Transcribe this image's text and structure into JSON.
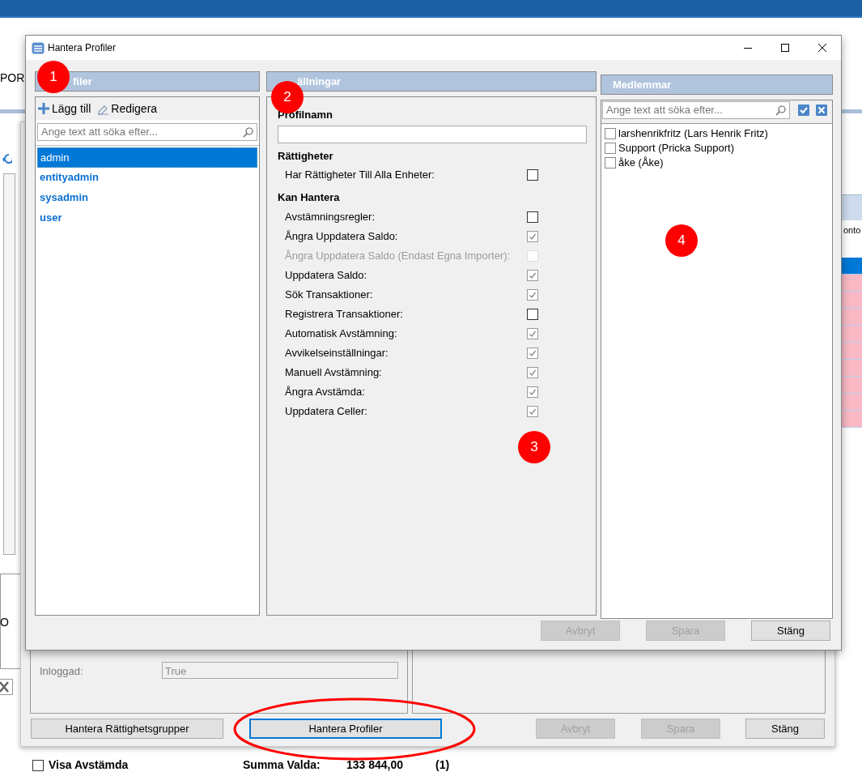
{
  "app": {
    "menu_text": "POR",
    "side_text": "O",
    "column_header": "onto",
    "grid_rows": [
      {
        "selected": true
      },
      {
        "selected": false
      },
      {
        "selected": false
      },
      {
        "selected": false
      },
      {
        "selected": false
      },
      {
        "selected": false
      },
      {
        "selected": false
      },
      {
        "selected": false
      },
      {
        "selected": false
      },
      {
        "selected": false
      }
    ],
    "status_bar": {
      "checkbox": {
        "label": "Visa Avstämda",
        "checked": false
      },
      "sum_label": "Summa Valda:",
      "sum_value": "133 844,00",
      "count": "(1)"
    }
  },
  "user_form": {
    "fields": [
      {
        "label": "Inloggad:",
        "value": "True"
      }
    ],
    "buttons": [
      {
        "label": "Hantera Rättighetsgrupper",
        "disabled": false,
        "focused": false
      },
      {
        "label": "Hantera Profiler",
        "disabled": false,
        "focused": true
      },
      {
        "label": "Avbryt",
        "disabled": true,
        "focused": false
      },
      {
        "label": "Spara",
        "disabled": true,
        "focused": false
      },
      {
        "label": "Stäng",
        "disabled": false,
        "focused": false
      }
    ]
  },
  "dialog": {
    "title": "Hantera Profiler",
    "profiles": {
      "header": "filer",
      "toolbar": [
        {
          "kind": "add",
          "label": "Lägg till"
        },
        {
          "kind": "edit",
          "label": "Redigera"
        }
      ],
      "search": {
        "placeholder": "Ange text att söka efter..."
      },
      "items": [
        {
          "label": "admin",
          "selected": true
        },
        {
          "label": "entityadmin",
          "selected": false
        },
        {
          "label": "sysadmin",
          "selected": false
        },
        {
          "label": "user",
          "selected": false
        }
      ]
    },
    "settings": {
      "header": "ällningar",
      "profile_name_label": "Profilnamn",
      "sections": [
        {
          "title": "Rättigheter",
          "items": [
            {
              "label": "Har Rättigheter Till Alla Enheter:",
              "checked": false,
              "disabled": false
            }
          ]
        },
        {
          "title": "Kan Hantera",
          "items": [
            {
              "label": "Avstämningsregler:",
              "checked": false,
              "disabled": false
            },
            {
              "label": "Ångra Uppdatera Saldo:",
              "checked": true,
              "disabled": false
            },
            {
              "label": "Ångra Uppdatera Saldo (Endast Egna Importer):",
              "checked": false,
              "disabled": true
            },
            {
              "label": "Uppdatera Saldo:",
              "checked": true,
              "disabled": false
            },
            {
              "label": "Sök Transaktioner:",
              "checked": true,
              "disabled": false
            },
            {
              "label": "Registrera Transaktioner:",
              "checked": false,
              "disabled": false
            },
            {
              "label": "Automatisk Avstämning:",
              "checked": true,
              "disabled": false
            },
            {
              "label": "Avvikelseinställningar:",
              "checked": true,
              "disabled": false
            },
            {
              "label": "Manuell Avstämning:",
              "checked": true,
              "disabled": false
            },
            {
              "label": "Ångra Avstämda:",
              "checked": true,
              "disabled": false
            },
            {
              "label": "Uppdatera Celler:",
              "checked": true,
              "disabled": false
            }
          ]
        }
      ]
    },
    "members": {
      "header": "Medlemmar",
      "search": {
        "placeholder": "Ange text att söka efter..."
      },
      "items": [
        {
          "label": "larshenrikfritz (Lars Henrik Fritz)",
          "checked": false
        },
        {
          "label": "Support (Pricka Support)",
          "checked": false
        },
        {
          "label": "åke (Åke)",
          "checked": false
        }
      ]
    },
    "buttons": [
      {
        "label": "Avbryt",
        "disabled": true,
        "focused": false
      },
      {
        "label": "Spara",
        "disabled": true,
        "focused": false
      },
      {
        "label": "Stäng",
        "disabled": false,
        "focused": false
      }
    ]
  },
  "annotations": [
    {
      "label": "1"
    },
    {
      "label": "2"
    },
    {
      "label": "3"
    },
    {
      "label": "4"
    }
  ]
}
